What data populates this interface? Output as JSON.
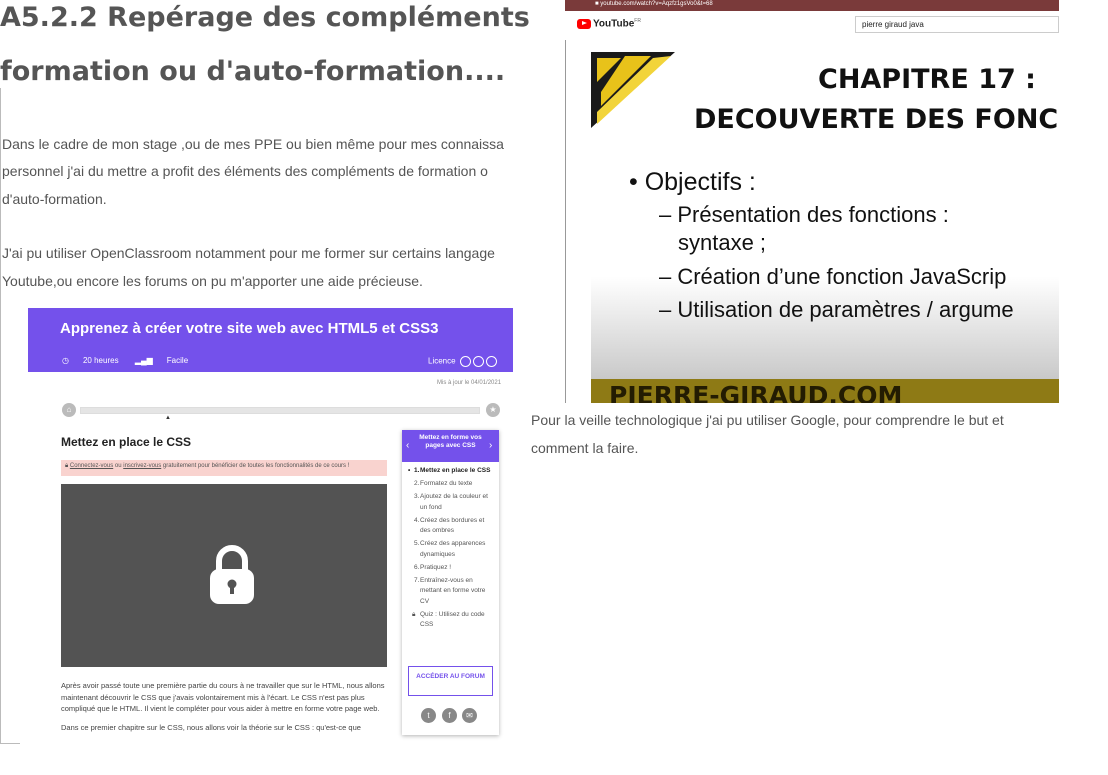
{
  "heading": {
    "line1": "A5.2.2 Repérage des compléments de",
    "line2": "formation ou d'auto-formation...."
  },
  "intro": {
    "p1_l1": "Dans le cadre de mon stage ,ou de mes PPE ou bien même pour mes connaissa",
    "p1_l2": "personnel j'ai du mettre a profit des éléments des compléments de formation o",
    "p1_l3": "d'auto-formation.",
    "p2_l1": "J'ai pu utiliser OpenClassroom notamment pour me former sur certains langage",
    "p2_l2": "Youtube,ou encore les forums on pu m'apporter une aide précieuse."
  },
  "openclassrooms": {
    "title": "Apprenez à créer votre site web avec HTML5 et CSS3",
    "duration": "20 heures",
    "level": "Facile",
    "licence": "Licence",
    "updated": "Mis à jour le 04/01/2021",
    "chapter_title": "Mettez en place le CSS",
    "alert_link1": "Connectez-vous",
    "alert_or": " ou ",
    "alert_link2": "inscrivez-vous",
    "alert_rest": " gratuitement pour bénéficier de toutes les fonctionnalités de ce cours !",
    "body1": "Après avoir passé toute une première partie du cours à ne travailler que sur le HTML, nous allons maintenant découvrir le CSS que j'avais volontairement mis à l'écart. Le CSS n'est pas plus compliqué que le HTML. Il vient le compléter pour vous aider à mettre en forme votre page web.",
    "body2": "Dans ce premier chapitre sur le CSS, nous allons voir la théorie sur le CSS : qu'est-ce que",
    "sidebar_title": "Mettez en forme vos pages avec CSS",
    "chapters": [
      {
        "num": "1.",
        "label": "Mettez en place le CSS"
      },
      {
        "num": "2.",
        "label": "Formatez du texte"
      },
      {
        "num": "3.",
        "label": "Ajoutez de la couleur et un fond"
      },
      {
        "num": "4.",
        "label": "Créez des bordures et des ombres"
      },
      {
        "num": "5.",
        "label": "Créez des apparences dynamiques"
      },
      {
        "num": "6.",
        "label": "Pratiquez !"
      },
      {
        "num": "7.",
        "label": "Entraînez-vous en mettant en forme votre CV"
      },
      {
        "num": "",
        "label": "Quiz : Utilisez du code CSS"
      }
    ],
    "forum_button": "ACCÉDER AU FORUM"
  },
  "youtube": {
    "url": "youtube.com/watch?v=Aqzfz1gsVo0&t=68",
    "logo": "YouTube",
    "logo_sup": "FR",
    "search": "pierre giraud java",
    "slide_title1": "CHAPITRE 17 :",
    "slide_title2": "DECOUVERTE DES FONC",
    "bullet": "• Objectifs :",
    "sub1a": "– Présentation   des   fonctions   :",
    "sub1b": "syntaxe ;",
    "sub2": "– Création d’une fonction JavaScrip",
    "sub3": "– Utilisation de paramètres / argume",
    "footer": "PIERRE-GIRAUD.COM"
  },
  "veille": {
    "line1": "Pour la veille technologique j'ai pu utiliser Google, pour comprendre le but et",
    "line2": "comment la faire."
  },
  "colors": {
    "oc_purple": "#7451eb",
    "yt_red": "#ff0000",
    "text_gray": "#555555",
    "slide_gold": "#8e7a15"
  }
}
